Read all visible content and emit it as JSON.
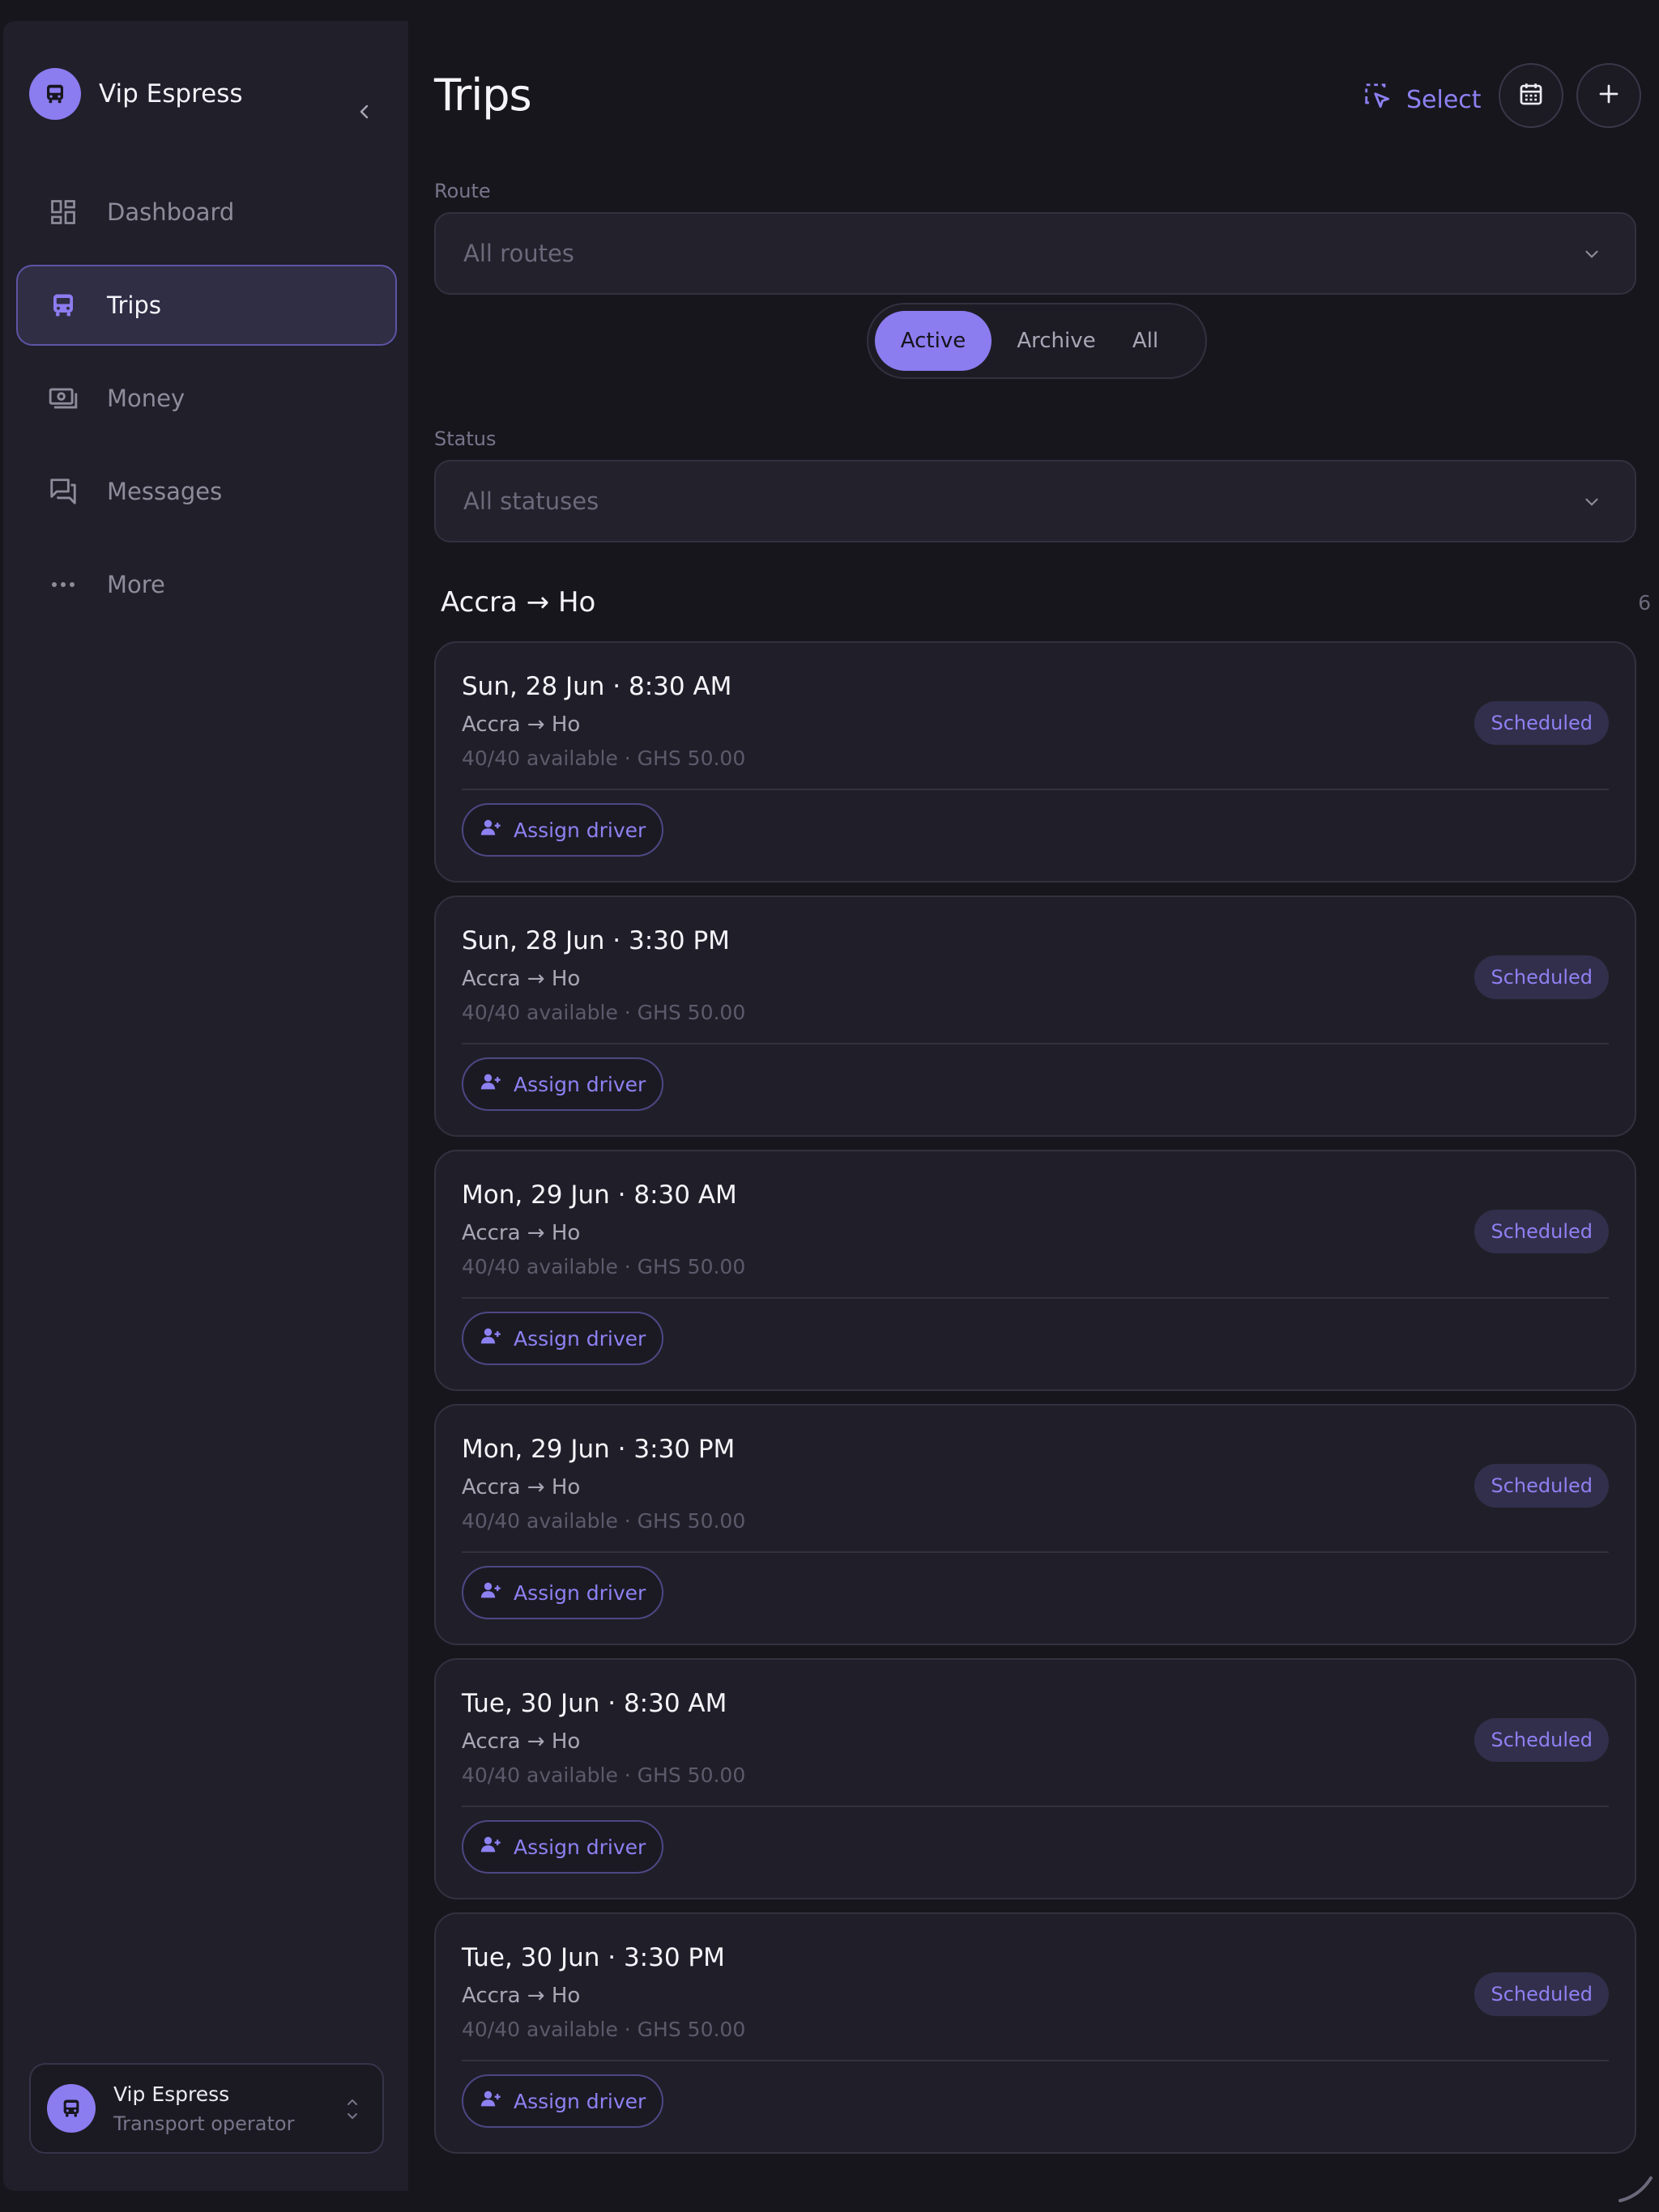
{
  "sidebar": {
    "brand_name": "Vip Espress",
    "items": [
      {
        "label": "Dashboard",
        "icon": "dashboard-icon"
      },
      {
        "label": "Trips",
        "icon": "bus-icon",
        "active": true
      },
      {
        "label": "Money",
        "icon": "money-icon"
      },
      {
        "label": "Messages",
        "icon": "messages-icon"
      },
      {
        "label": "More",
        "icon": "more-icon"
      }
    ],
    "account": {
      "name": "Vip Espress",
      "role": "Transport operator"
    }
  },
  "header": {
    "title": "Trips",
    "select_label": "Select"
  },
  "filters": {
    "route_label": "Route",
    "route_value": "All routes",
    "tabs": [
      "Active",
      "Archive",
      "All"
    ],
    "active_tab": "Active",
    "status_label": "Status",
    "status_value": "All statuses"
  },
  "group": {
    "title": "Accra → Ho",
    "count": "6"
  },
  "trips": [
    {
      "date": "Sun, 28 Jun · 8:30 AM",
      "route": "Accra  →  Ho",
      "meta": "40/40 available · GHS 50.00",
      "status": "Scheduled",
      "action": "Assign driver"
    },
    {
      "date": "Sun, 28 Jun · 3:30 PM",
      "route": "Accra  →  Ho",
      "meta": "40/40 available · GHS 50.00",
      "status": "Scheduled",
      "action": "Assign driver"
    },
    {
      "date": "Mon, 29 Jun · 8:30 AM",
      "route": "Accra  →  Ho",
      "meta": "40/40 available · GHS 50.00",
      "status": "Scheduled",
      "action": "Assign driver"
    },
    {
      "date": "Mon, 29 Jun · 3:30 PM",
      "route": "Accra  →  Ho",
      "meta": "40/40 available · GHS 50.00",
      "status": "Scheduled",
      "action": "Assign driver"
    },
    {
      "date": "Tue, 30 Jun · 8:30 AM",
      "route": "Accra  →  Ho",
      "meta": "40/40 available · GHS 50.00",
      "status": "Scheduled",
      "action": "Assign driver"
    },
    {
      "date": "Tue, 30 Jun · 3:30 PM",
      "route": "Accra  →  Ho",
      "meta": "40/40 available · GHS 50.00",
      "status": "Scheduled",
      "action": "Assign driver"
    }
  ],
  "colors": {
    "accent": "#8b7cf0",
    "background": "#17161d",
    "sidebar": "#201f2a"
  }
}
